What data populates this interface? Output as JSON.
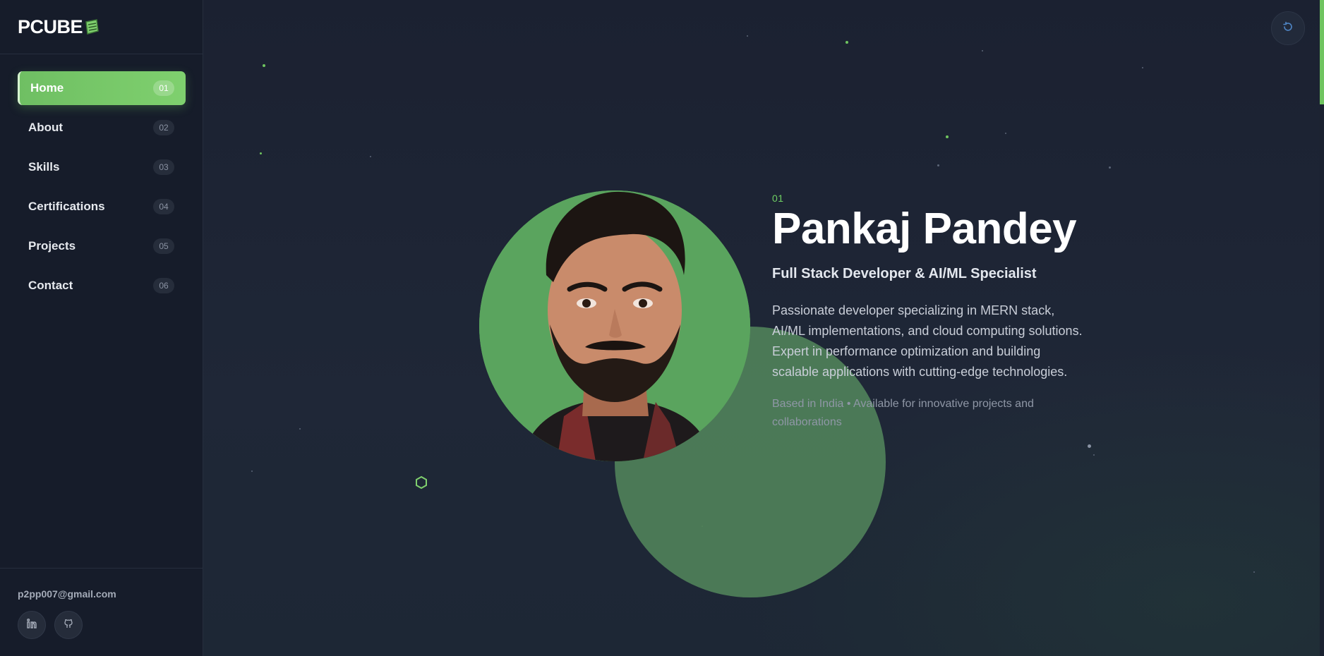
{
  "brand": {
    "logo_text": "PCUBE",
    "logo_icon": "book-stack-icon"
  },
  "sidebar": {
    "items": [
      {
        "label": "Home",
        "num": "01",
        "active": true
      },
      {
        "label": "About",
        "num": "02"
      },
      {
        "label": "Skills",
        "num": "03"
      },
      {
        "label": "Certifications",
        "num": "04"
      },
      {
        "label": "Projects",
        "num": "05"
      },
      {
        "label": "Contact",
        "num": "06"
      }
    ],
    "email": "p2pp007@gmail.com",
    "socials": [
      {
        "icon": "linkedin-icon"
      },
      {
        "icon": "github-icon"
      }
    ]
  },
  "topbar": {
    "theme_toggle_icon": "refresh-icon"
  },
  "hero": {
    "section_num": "01",
    "name": "Pankaj Pandey",
    "role": "Full Stack Developer & AI/ML Specialist",
    "description": "Passionate developer specializing in MERN stack, AI/ML implementations, and cloud computing solutions. Expert in performance optimization and building scalable applications with cutting-edge technologies.",
    "location": "Based in India • Available for innovative projects and collaborations"
  },
  "colors": {
    "accent": "#6fc45f",
    "background": "#1c2333",
    "sidebar": "#161c2a"
  }
}
